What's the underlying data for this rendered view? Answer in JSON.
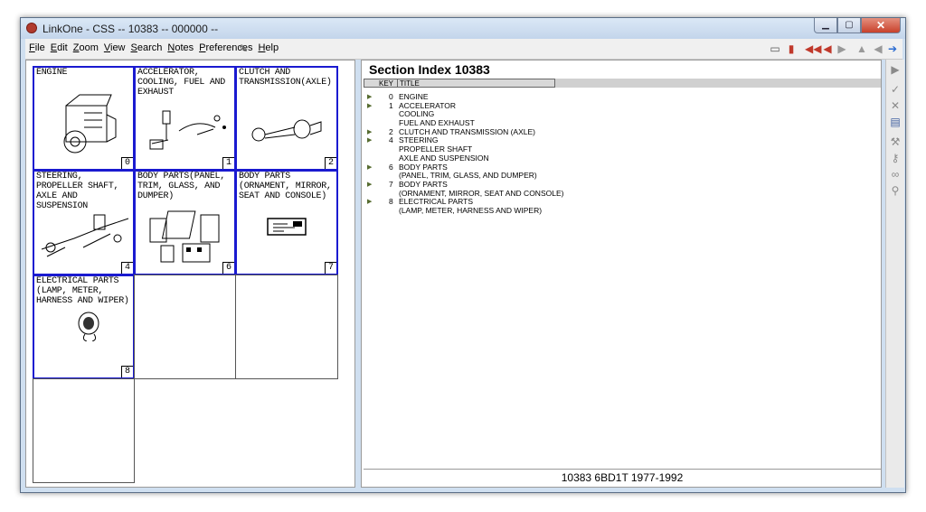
{
  "window": {
    "title": "LinkOne - CSS -- 10383 -- 000000 --",
    "minimize": "▁",
    "maximize": "▢",
    "close": "✕"
  },
  "menu": [
    "File",
    "Edit",
    "Zoom",
    "View",
    "Search",
    "Notes",
    "Preferences",
    "Help"
  ],
  "toolbar_icons": [
    "pin-icon",
    "book-icon",
    "bookmark-icon",
    "first-icon",
    "previous-icon",
    "next-icon",
    "up-icon",
    "back-icon",
    "forward-icon"
  ],
  "grid": [
    {
      "label": "ENGINE",
      "num": "0"
    },
    {
      "label": "ACCELERATOR,\nCOOLING, FUEL AND\nEXHAUST",
      "num": "1"
    },
    {
      "label": "CLUTCH AND\nTRANSMISSION(AXLE)",
      "num": "2"
    },
    {
      "label": "STEERING,\nPROPELLER SHAFT,\nAXLE AND\nSUSPENSION",
      "num": "4"
    },
    {
      "label": "BODY PARTS(PANEL,\nTRIM, GLASS, AND\nDUMPER)",
      "num": "6"
    },
    {
      "label": "BODY PARTS\n(ORNAMENT, MIRROR,\nSEAT AND CONSOLE)",
      "num": "7"
    },
    {
      "label": "ELECTRICAL PARTS\n(LAMP, METER,\nHARNESS AND WIPER)",
      "num": "8"
    }
  ],
  "index": {
    "title": "Section Index 10383",
    "col_key": "KEY",
    "col_title": "TITLE",
    "rows": [
      {
        "key": "0",
        "lines": [
          "ENGINE"
        ]
      },
      {
        "key": "1",
        "lines": [
          "ACCELERATOR",
          "COOLING",
          "FUEL AND EXHAUST"
        ]
      },
      {
        "key": "2",
        "lines": [
          "CLUTCH AND TRANSMISSION (AXLE)"
        ]
      },
      {
        "key": "4",
        "lines": [
          "STEERING",
          "PROPELLER SHAFT",
          "AXLE AND SUSPENSION"
        ]
      },
      {
        "key": "6",
        "lines": [
          "BODY PARTS",
          "(PANEL, TRIM, GLASS, AND DUMPER)"
        ]
      },
      {
        "key": "7",
        "lines": [
          "BODY PARTS",
          "(ORNAMENT, MIRROR, SEAT AND CONSOLE)"
        ]
      },
      {
        "key": "8",
        "lines": [
          "ELECTRICAL PARTS",
          "(LAMP, METER, HARNESS AND WIPER)"
        ]
      }
    ],
    "status": "10383 6BD1T 1977-1992"
  },
  "side_icons": [
    "play-icon",
    "check-icon",
    "close-icon",
    "notes-icon",
    "wrench-icon",
    "key-icon",
    "binoculars-icon",
    "magnifier-icon"
  ],
  "colors": {
    "active_border": "#1a1ad0",
    "arrow": "#556b2f",
    "close_btn": "#c8412b"
  }
}
